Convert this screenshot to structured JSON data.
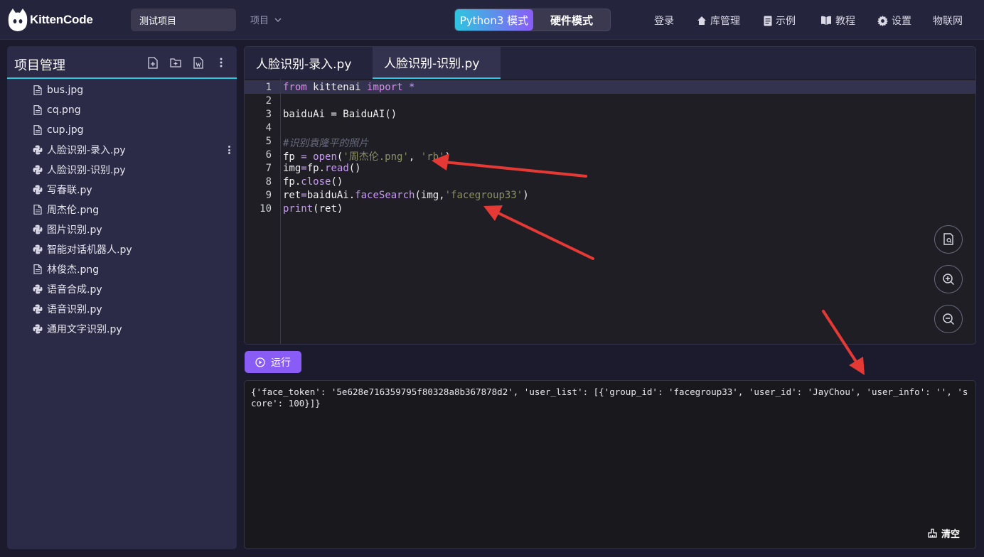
{
  "app": {
    "logo_text": "KittenCode"
  },
  "header": {
    "project_name": "测试项目",
    "project_menu": "项目",
    "modes": [
      "Python3 模式",
      "硬件模式"
    ],
    "nav": [
      "登录",
      "库管理",
      "示例",
      "教程",
      "设置",
      "物联网"
    ]
  },
  "sidebar": {
    "title": "项目管理",
    "files": [
      {
        "name": "bus.jpg",
        "type": "file"
      },
      {
        "name": "cq.png",
        "type": "file"
      },
      {
        "name": "cup.jpg",
        "type": "file"
      },
      {
        "name": "人脸识别-录入.py",
        "type": "python"
      },
      {
        "name": "人脸识别-识别.py",
        "type": "python"
      },
      {
        "name": "写春联.py",
        "type": "python"
      },
      {
        "name": "周杰伦.png",
        "type": "file"
      },
      {
        "name": "图片识别.py",
        "type": "python"
      },
      {
        "name": "智能对话机器人.py",
        "type": "python"
      },
      {
        "name": "林俊杰.png",
        "type": "file"
      },
      {
        "name": "语音合成.py",
        "type": "python"
      },
      {
        "name": "语音识别.py",
        "type": "python"
      },
      {
        "name": "通用文字识别.py",
        "type": "python"
      }
    ]
  },
  "editor": {
    "tabs": [
      "人脸识别-录入.py",
      "人脸识别-识别.py"
    ],
    "active_tab": 1,
    "line_numbers": [
      "1",
      "2",
      "3",
      "4",
      "5",
      "6",
      "7",
      "8",
      "9",
      "10"
    ],
    "code": {
      "l1_kw1": "from",
      "l1_mod": " kittenai ",
      "l1_kw2": "import",
      "l1_star": " *",
      "l3": "baiduAi = BaiduAI()",
      "l5_comment": "#识别袁隆平的照片",
      "l6_a": "fp ",
      "l6_eq": "=",
      "l6_fn": " open",
      "l6_p1": "(",
      "l6_s1": "'周杰伦.png'",
      "l6_c": ", ",
      "l6_s2": "'rb'",
      "l6_p2": ")",
      "l7_a": "img",
      "l7_eq": "=",
      "l7_b": "fp.",
      "l7_fn": "read",
      "l7_p": "()",
      "l8_a": "fp.",
      "l8_fn": "close",
      "l8_p": "()",
      "l9_a": "ret",
      "l9_eq": "=",
      "l9_b": "baiduAi.",
      "l9_fn": "faceSearch",
      "l9_c": "(img,",
      "l9_s": "'facegroup33'",
      "l9_p": ")",
      "l10_fn": "print",
      "l10_p": "(ret)"
    }
  },
  "run_button": {
    "label": "运行"
  },
  "output": {
    "text": "{'face_token': '5e628e716359795f80328a8b367878d2', 'user_list': [{'group_id': 'facegroup33', 'user_id': 'JayChou', 'user_info': '', 'score': 100}]}",
    "clear_label": "清空"
  },
  "colors": {
    "accent_cyan": "#2ec5e0",
    "accent_purple": "#8a5cf6",
    "arrow_red": "#e53935"
  }
}
